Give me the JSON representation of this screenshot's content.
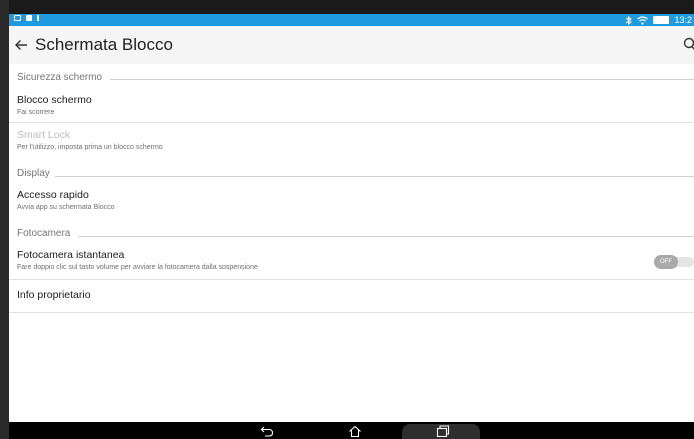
{
  "status_bar": {
    "time": "13:2"
  },
  "toolbar": {
    "title": "Schermata Blocco"
  },
  "sections": {
    "security": {
      "header": "Sicurezza schermo",
      "screen_lock_title": "Blocco schermo",
      "screen_lock_subtitle": "Fai scorrere",
      "smart_lock_title": "Smart Lock",
      "smart_lock_subtitle": "Per l'utilizzo, imposta prima un blocco schermo"
    },
    "display": {
      "header": "Display",
      "quick_access_title": "Accesso rapido",
      "quick_access_subtitle": "Avvia app su schermata Blocco"
    },
    "camera": {
      "header": "Fotocamera",
      "instant_camera_title": "Fotocamera istantanea",
      "instant_camera_subtitle": "Fare doppio clic sul tasto volume per avviare la fotocamera dalla sospensione",
      "toggle_label": "OFF"
    },
    "owner": {
      "owner_info_title": "Info proprietario"
    }
  },
  "colors": {
    "status_bar": "#1e9be0",
    "background": "#ffffff",
    "header_text": "#757575"
  },
  "icons": {
    "back": "arrow-back-icon",
    "search": "search-icon",
    "nav_back": "back-icon",
    "nav_home": "home-icon",
    "nav_recent": "recent-apps-icon"
  }
}
